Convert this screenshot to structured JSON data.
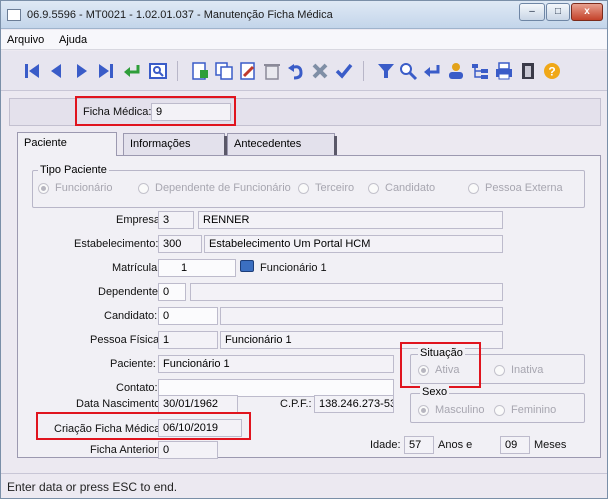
{
  "window": {
    "title": "06.9.5596 - MT0021 - 1.02.01.037 - Manutenção Ficha Médica",
    "controls": [
      "–",
      "□",
      "x"
    ]
  },
  "menu": [
    "Arquivo",
    "Ajuda"
  ],
  "toolbar": {
    "icons": [
      "first-record-icon",
      "previous-record-icon",
      "next-record-icon",
      "last-record-icon",
      "go-to-icon",
      "search-record-icon",
      "new-icon",
      "copy-icon",
      "edit-icon",
      "delete-icon",
      "undo-icon",
      "cancel-icon",
      "save-icon",
      "filter-icon",
      "zoom-icon",
      "list-icon",
      "user-icon",
      "tree-icon",
      "print-icon",
      "exit-icon",
      "help-icon"
    ]
  },
  "header": {
    "ficha_label": "Ficha Médica:",
    "ficha_value": "9"
  },
  "tabs": [
    "Paciente",
    "Informações",
    "Antecedentes"
  ],
  "tipo_paciente": {
    "title": "Tipo Paciente",
    "options": [
      "Funcionário",
      "Dependente de Funcionário",
      "Terceiro",
      "Candidato",
      "Pessoa Externa"
    ],
    "selected": "Funcionário"
  },
  "form": {
    "empresa_label": "Empresa:",
    "empresa_code": "3",
    "empresa_name": "RENNER",
    "estabelecimento_label": "Estabelecimento:",
    "estabelecimento_code": "300",
    "estabelecimento_name": "Estabelecimento Um Portal HCM",
    "matricula_label": "Matrícula:",
    "matricula_value": "1",
    "matricula_name": "Funcionário 1",
    "dependente_label": "Dependente:",
    "dependente_value": "0",
    "candidato_label": "Candidato:",
    "candidato_value": "0",
    "pessoa_fisica_label": "Pessoa Física:",
    "pessoa_fisica_code": "1",
    "pessoa_fisica_name": "Funcionário 1",
    "paciente_label": "Paciente:",
    "paciente_value": "Funcionário 1",
    "contato_label": "Contato:",
    "contato_value": "",
    "data_nascimento_label": "Data Nascimento:",
    "data_nascimento_value": "30/01/1962",
    "cpf_label": "C.P.F.:",
    "cpf_value": "138.246.273-53",
    "criacao_label": "Criação Ficha Médica:",
    "criacao_value": "06/10/2019",
    "ficha_anterior_label": "Ficha Anterior:",
    "ficha_anterior_value": "0",
    "idade_label": "Idade:",
    "idade_anos_value": "57",
    "anos_label": "Anos e",
    "idade_meses_value": "09",
    "meses_label": "Meses"
  },
  "situacao": {
    "title": "Situação",
    "options": [
      "Ativa",
      "Inativa"
    ],
    "selected": "Ativa"
  },
  "sexo": {
    "title": "Sexo",
    "options": [
      "Masculino",
      "Feminino"
    ],
    "selected": "Masculino"
  },
  "status_bar": "Enter data or press ESC to end.",
  "colors": {
    "highlight": "#e0141e",
    "toolbar_nav": "#3a5cc8",
    "disabled_text": "#a7a6b0"
  }
}
